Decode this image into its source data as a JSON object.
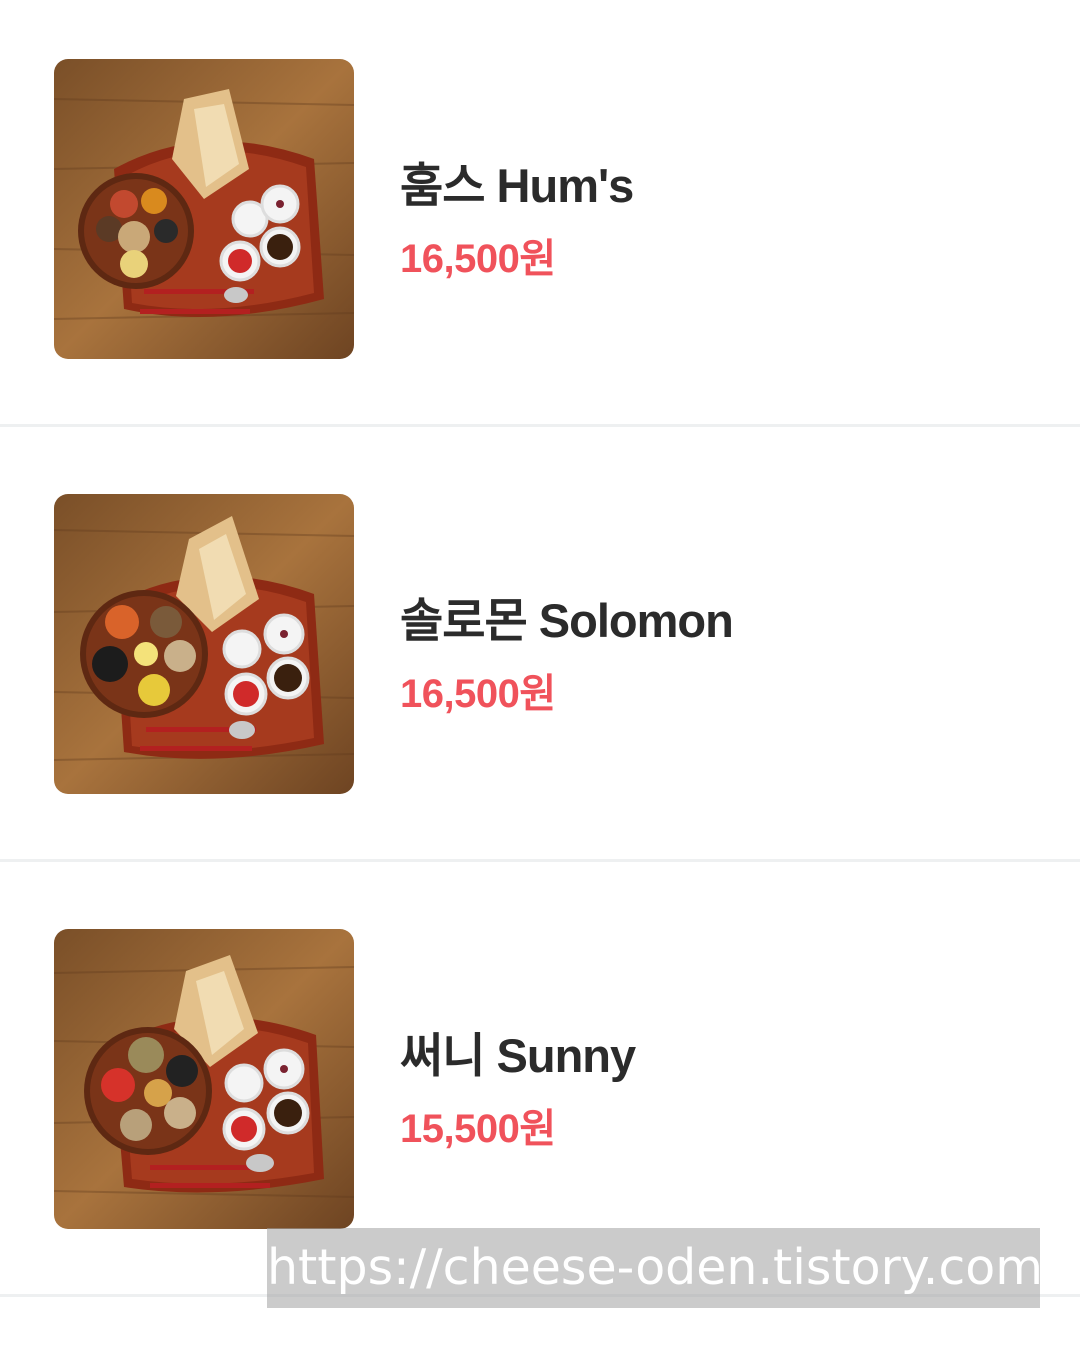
{
  "menu": {
    "items": [
      {
        "name": "훔스 Hum's",
        "price": "16,500원",
        "bowl": [
          "#c2492f",
          "#d98a1e",
          "#5b3a25",
          "#e9d27a",
          "#c9a878",
          "#2a2a2a"
        ]
      },
      {
        "name": "솔로몬 Solomon",
        "price": "16,500원",
        "bowl": [
          "#d9632a",
          "#7a5a3a",
          "#1c1c1c",
          "#e7c93a",
          "#c9b08a",
          "#f4e27a"
        ]
      },
      {
        "name": "써니 Sunny",
        "price": "15,500원",
        "bowl": [
          "#9a8a5a",
          "#222222",
          "#d6a24a",
          "#c9b08a",
          "#d6322a",
          "#b8a07a"
        ]
      }
    ]
  },
  "watermark": {
    "text": "https://cheese-oden.tistory.com"
  },
  "colors": {
    "price": "#f0525b",
    "name": "#2b2b2b",
    "divider": "#eef0f1"
  }
}
